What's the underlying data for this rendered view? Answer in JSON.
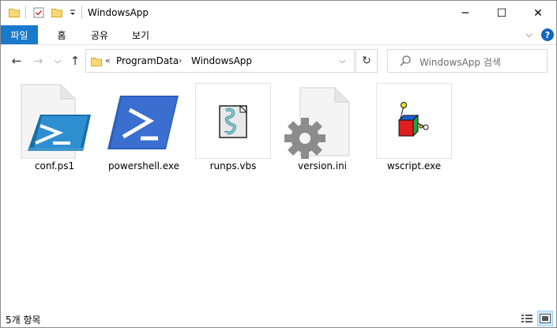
{
  "window": {
    "title": "WindowsApp",
    "minimize_glyph": "─",
    "maximize_glyph": "☐",
    "close_glyph": "✕"
  },
  "ribbon": {
    "tabs": [
      "파일",
      "홈",
      "공유",
      "보기"
    ],
    "collapse_glyph": "⌵",
    "help_glyph": "?"
  },
  "navigation": {
    "back_glyph": "←",
    "forward_glyph": "→",
    "recent_glyph": "⌵",
    "up_glyph": "↑",
    "address": {
      "overflow": "«",
      "parts": [
        "ProgramData",
        "WindowsApp"
      ],
      "separator": "›",
      "dropdown_glyph": "⌵"
    },
    "refresh_glyph": "↻",
    "search_placeholder": "WindowsApp 검색"
  },
  "files": [
    {
      "name": "conf.ps1",
      "icon": "powershell-script-icon"
    },
    {
      "name": "powershell.exe",
      "icon": "powershell-icon"
    },
    {
      "name": "runps.vbs",
      "icon": "vbs-script-icon"
    },
    {
      "name": "version.ini",
      "icon": "settings-file-icon"
    },
    {
      "name": "wscript.exe",
      "icon": "wscript-icon"
    }
  ],
  "status": {
    "item_count": "5개 항목"
  },
  "colors": {
    "accent": "#1979ca",
    "powershell_blue": "#2d5fba",
    "folder_yellow": "#f8d775"
  }
}
